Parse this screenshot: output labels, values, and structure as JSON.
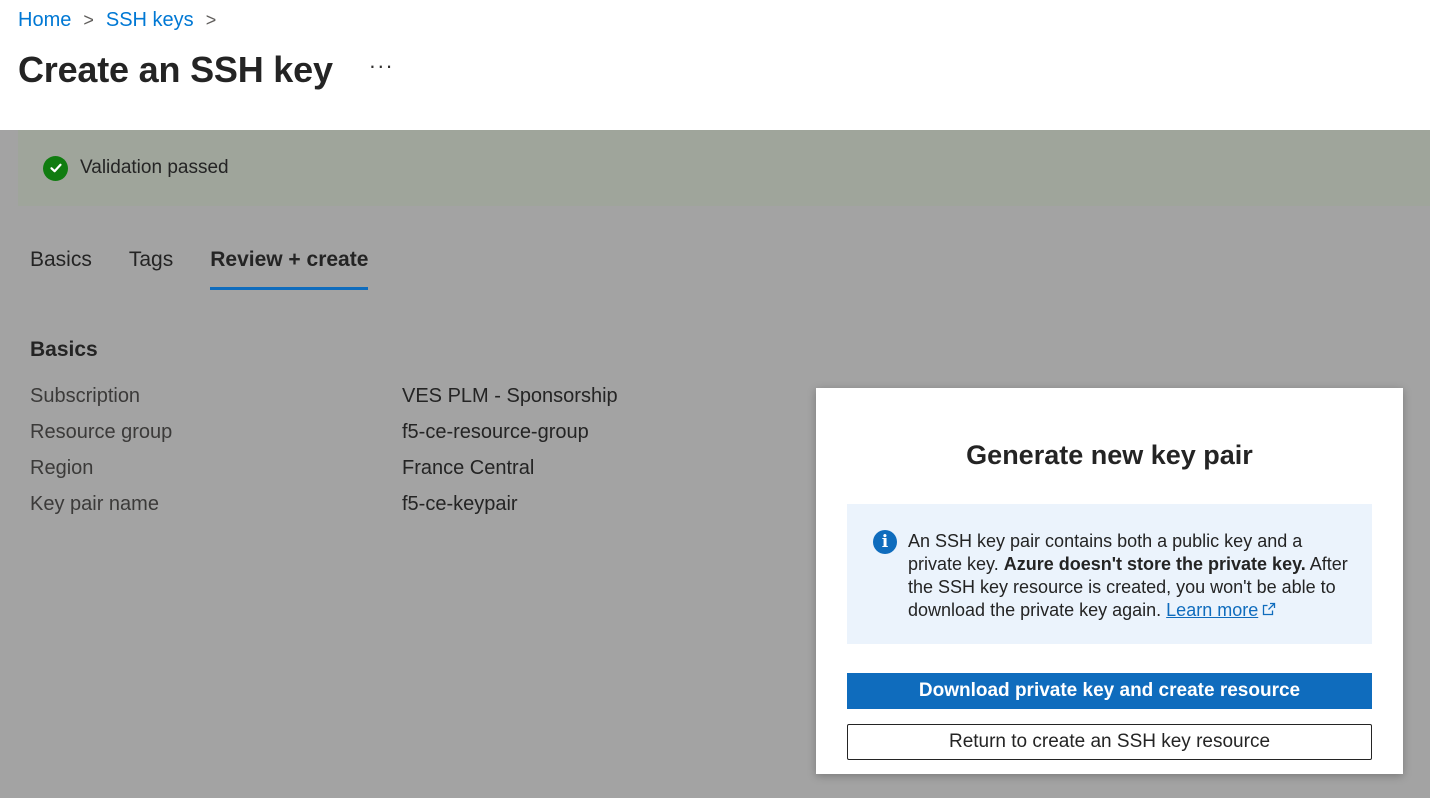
{
  "breadcrumb": {
    "home": "Home",
    "ssh_keys": "SSH keys",
    "separator": ">"
  },
  "header": {
    "title": "Create an SSH key",
    "more": "···"
  },
  "validation": {
    "text": "Validation passed",
    "icon": "checkmark-circle-icon",
    "color": "#107c10"
  },
  "tabs": [
    {
      "label": "Basics",
      "active": false
    },
    {
      "label": "Tags",
      "active": false
    },
    {
      "label": "Review + create",
      "active": true
    }
  ],
  "basics": {
    "title": "Basics",
    "rows": [
      {
        "label": "Subscription",
        "value": "VES PLM - Sponsorship"
      },
      {
        "label": "Resource group",
        "value": "f5-ce-resource-group"
      },
      {
        "label": "Region",
        "value": "France Central"
      },
      {
        "label": "Key pair name",
        "value": "f5-ce-keypair"
      }
    ]
  },
  "dialog": {
    "title": "Generate new key pair",
    "info": {
      "icon": "info-icon",
      "text_1": "An SSH key pair contains both a public key and a private key. ",
      "bold": "Azure doesn't store the private key.",
      "text_2": " After the SSH key resource is created, you won't be able to download the private key again. ",
      "link": "Learn more"
    },
    "primary_button": "Download private key and create resource",
    "secondary_button": "Return to create an SSH key resource"
  },
  "colors": {
    "accent": "#0f6cbd",
    "link": "#0078d4",
    "overlay": "#a3a3a3"
  }
}
